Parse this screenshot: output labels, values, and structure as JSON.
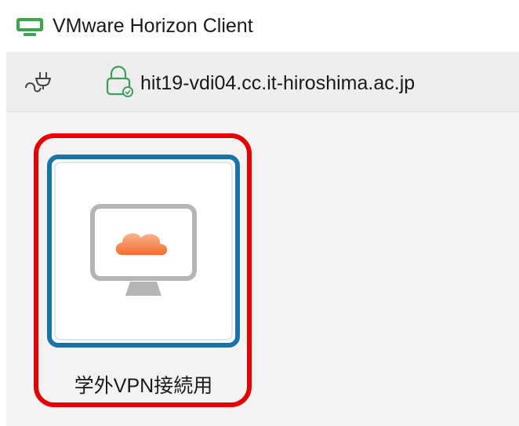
{
  "window": {
    "title": "VMware Horizon Client"
  },
  "server_bar": {
    "host": "hit19-vdi04.cc.it-hiroshima.ac.jp"
  },
  "desktops": [
    {
      "label": "学外VPN接続用"
    }
  ],
  "icons": {
    "app": "horizon-client-icon",
    "plug": "plug-icon",
    "lock": "lock-icon",
    "desktop": "desktop-cloud-icon"
  },
  "colors": {
    "tile_border": "#1a73a8",
    "highlight": "#e60000",
    "cloud_top": "#f9b48f",
    "cloud_bottom": "#f26f2c",
    "app_icon_green": "#3aa84a",
    "lock_green": "#3f9f5a"
  }
}
